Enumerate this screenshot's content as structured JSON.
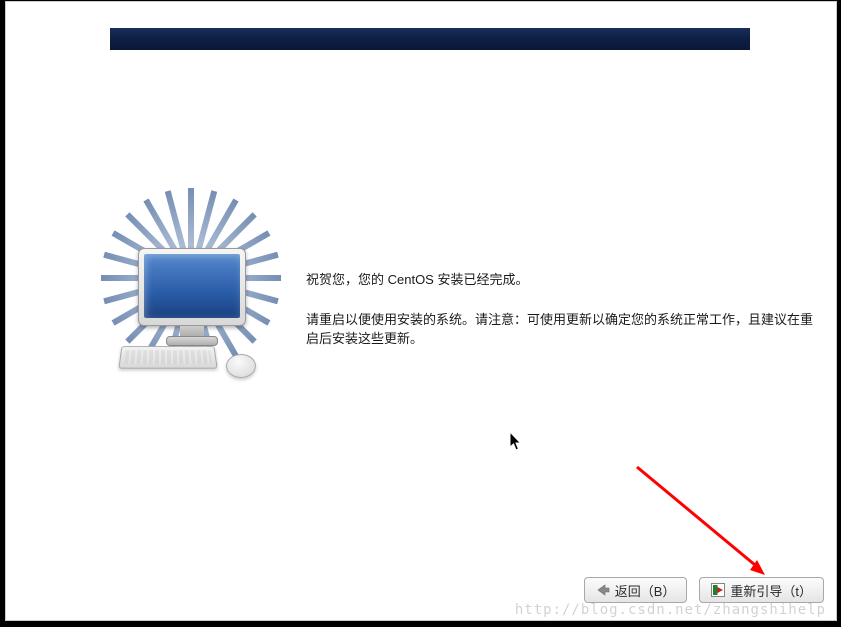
{
  "content": {
    "congratulations": "祝贺您，您的 CentOS 安装已经完成。",
    "instruction": "请重启以便使用安装的系统。请注意：可使用更新以确定您的系统正常工作，且建议在重启后安装这些更新。"
  },
  "buttons": {
    "back": {
      "label": "返回（B）",
      "icon": "arrow-left-icon"
    },
    "reboot": {
      "label": "重新引导（t）",
      "icon": "reboot-icon"
    }
  },
  "watermark": "http://blog.csdn.net/zhangshihelp"
}
